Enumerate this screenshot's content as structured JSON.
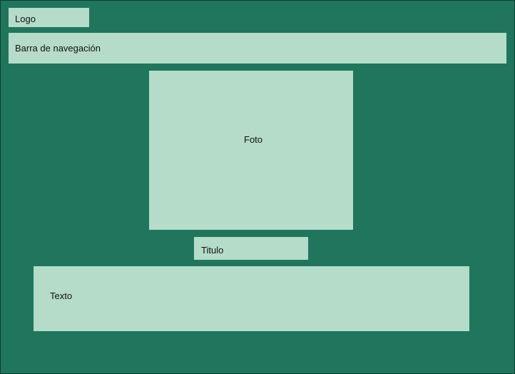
{
  "header": {
    "logo_label": "Logo",
    "nav_label": "Barra de navegación"
  },
  "main": {
    "photo_label": "Foto",
    "title_label": "Titulo",
    "text_label": "Texto"
  },
  "colors": {
    "background": "#1f765d",
    "placeholder": "#b5dcc8",
    "text": "#111111"
  }
}
